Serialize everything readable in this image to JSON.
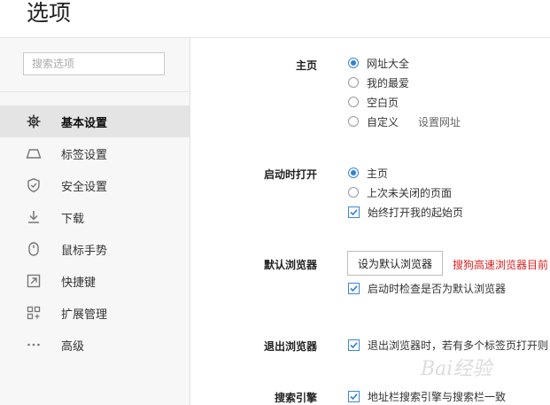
{
  "header": {
    "title": "选项"
  },
  "sidebar": {
    "search_placeholder": "搜索选项",
    "items": [
      {
        "label": "基本设置",
        "icon": "gear-icon",
        "active": true
      },
      {
        "label": "标签设置",
        "icon": "tab-icon",
        "active": false
      },
      {
        "label": "安全设置",
        "icon": "shield-icon",
        "active": false
      },
      {
        "label": "下载",
        "icon": "download-icon",
        "active": false
      },
      {
        "label": "鼠标手势",
        "icon": "mouse-icon",
        "active": false
      },
      {
        "label": "快捷键",
        "icon": "shortcut-icon",
        "active": false
      },
      {
        "label": "扩展管理",
        "icon": "extension-grid-icon",
        "active": false
      },
      {
        "label": "高级",
        "icon": "more-dots-icon",
        "active": false
      }
    ]
  },
  "sections": {
    "homepage": {
      "label": "主页",
      "options": [
        {
          "label": "网址大全",
          "selected": true
        },
        {
          "label": "我的最爱",
          "selected": false
        },
        {
          "label": "空白页",
          "selected": false
        },
        {
          "label": "自定义",
          "selected": false
        }
      ],
      "set_url_link": "设置网址"
    },
    "startup": {
      "label": "启动时打开",
      "options": [
        {
          "label": "主页",
          "selected": true
        },
        {
          "label": "上次未关闭的页面",
          "selected": false
        }
      ],
      "always_open_start": {
        "label": "始终打开我的起始页",
        "checked": true
      }
    },
    "default_browser": {
      "label": "默认浏览器",
      "button_label": "设为默认浏览器",
      "note": "搜狗高速浏览器目前",
      "check_on_start": {
        "label": "启动时检查是否为默认浏览器",
        "checked": true
      }
    },
    "exit_browser": {
      "label": "退出浏览器",
      "warn_multi_tabs": {
        "label": "退出浏览器时，若有多个标签页打开则",
        "checked": true
      }
    },
    "search_engine": {
      "label": "搜索引擎",
      "sync_engine": {
        "label": "地址栏搜索引擎与搜索栏一致",
        "checked": true
      }
    }
  },
  "watermark": {
    "text": "Bai经验"
  },
  "colors": {
    "accent": "#2f7fd6",
    "warning": "#e02020",
    "sidebar_bg": "#f7f7f7",
    "active_item_bg": "#e4e4e4"
  }
}
